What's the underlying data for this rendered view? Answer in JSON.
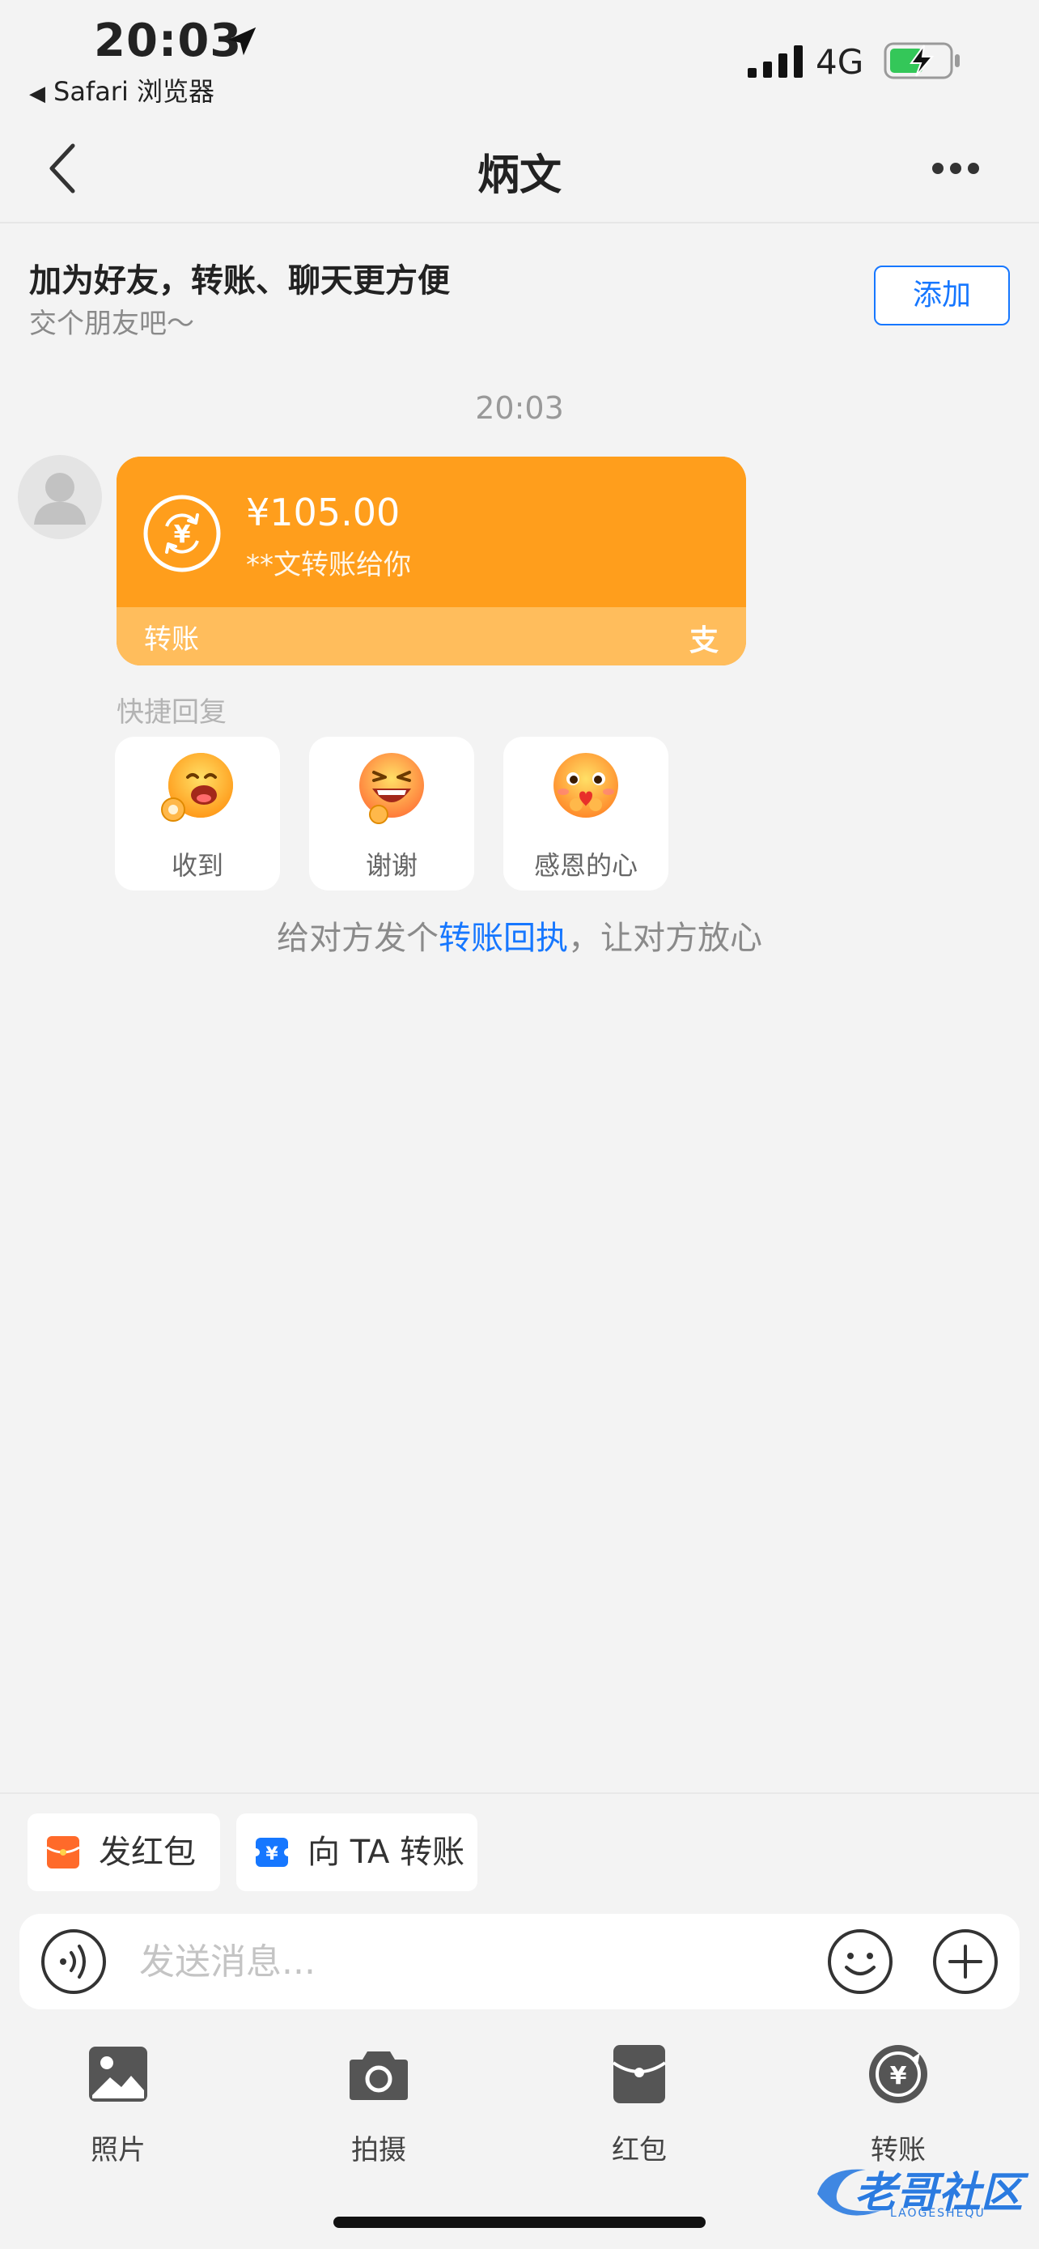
{
  "status_bar": {
    "time": "20:03",
    "back_app": "Safari 浏览器",
    "network": "4G",
    "battery_color": "#34c759"
  },
  "nav": {
    "title": "炳文"
  },
  "friend_banner": {
    "title": "加为好友，转账、聊天更方便",
    "subtitle": "交个朋友吧～",
    "add_button": "添加"
  },
  "chat": {
    "timestamp": "20:03",
    "transfer": {
      "amount": "¥105.00",
      "description": "**文转账给你",
      "label": "转账",
      "logo_glyph": "支",
      "color": "#ff9e1c"
    },
    "quick_reply": {
      "title": "快捷回复",
      "items": [
        {
          "label": "收到",
          "icon": "ok-hand-emoji-icon"
        },
        {
          "label": "谢谢",
          "icon": "laughing-emoji-icon"
        },
        {
          "label": "感恩的心",
          "icon": "grateful-emoji-icon"
        }
      ]
    },
    "receipt_tip": {
      "prefix": "给对方发个",
      "link": "转账回执",
      "suffix": "，让对方放心"
    }
  },
  "chips": {
    "red_packet": "发红包",
    "transfer": "向 TA 转账"
  },
  "composer": {
    "placeholder": "发送消息..."
  },
  "tools": [
    {
      "label": "照片",
      "icon": "photo-icon"
    },
    {
      "label": "拍摄",
      "icon": "camera-icon"
    },
    {
      "label": "红包",
      "icon": "red-packet-icon"
    },
    {
      "label": "转账",
      "icon": "transfer-icon"
    }
  ],
  "watermark": {
    "text": "老哥社区",
    "sub": "LAOGESHEQU"
  },
  "colors": {
    "accent_blue": "#1677ff",
    "orange": "#ff9e1c",
    "orange_light": "#ffbd5c"
  }
}
